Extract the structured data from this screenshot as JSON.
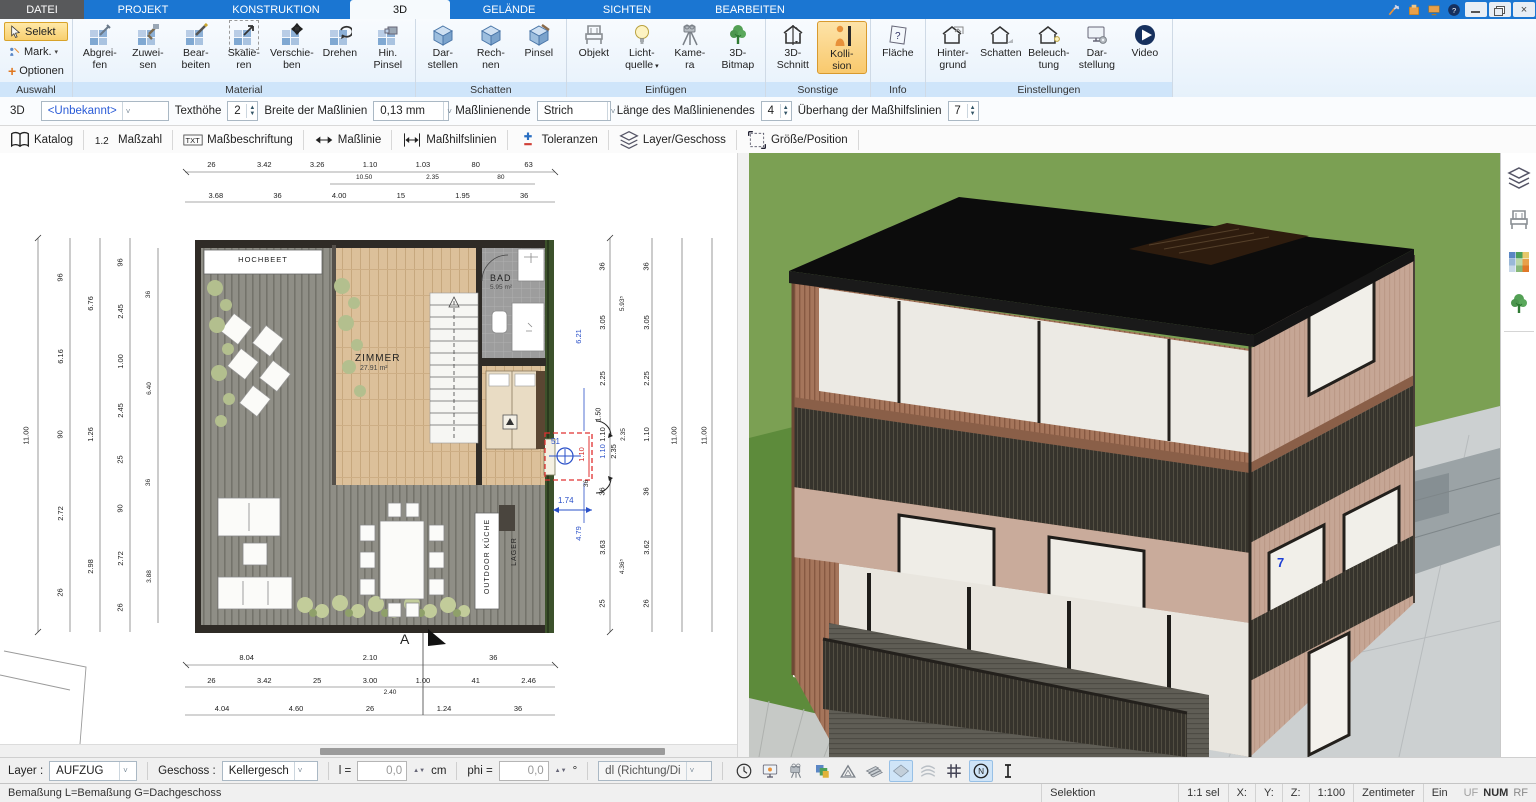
{
  "titlebar": {
    "tabs": [
      "DATEI",
      "PROJEKT",
      "KONSTRUKTION",
      "3D",
      "GELÄNDE",
      "SICHTEN",
      "BEARBEITEN"
    ],
    "active_tab": "3D"
  },
  "ribbon": {
    "selekt": "Selekt",
    "mark": "Mark.",
    "optionen": "Optionen",
    "groups": [
      {
        "label": "Auswahl"
      },
      {
        "label": "Material",
        "buttons": [
          {
            "label": "Abgrei-\nfen",
            "icon": "#i-g-pip"
          },
          {
            "label": "Zuwei-\nsen",
            "icon": "#i-g-brush"
          },
          {
            "label": "Bear-\nbeiten",
            "icon": "#i-g-pen"
          },
          {
            "label": "Skalie-\nren",
            "icon": "#i-g-scale"
          },
          {
            "label": "Verschie-\nben",
            "icon": "#i-g-move"
          },
          {
            "label": "Drehen",
            "icon": "#i-g-rot"
          },
          {
            "label": "Hin.\nPinsel",
            "icon": "#i-g-cam"
          }
        ]
      },
      {
        "label": "Schatten",
        "buttons": [
          {
            "label": "Dar-\nstellen",
            "icon": "#i-cube"
          },
          {
            "label": "Rech-\nnen",
            "icon": "#i-cube"
          },
          {
            "label": "Pinsel",
            "icon": "#i-cube-b"
          }
        ]
      },
      {
        "label": "Einfügen",
        "buttons": [
          {
            "label": "Objekt",
            "icon": "#i-chair"
          },
          {
            "label": "Licht-\nquelle",
            "icon": "#i-bulb"
          },
          {
            "label": "Kame-\nra",
            "icon": "#i-camera"
          },
          {
            "label": "3D-\nBitmap",
            "icon": "#i-tree"
          }
        ]
      },
      {
        "label": "Sonstige",
        "buttons": [
          {
            "label": "3D-\nSchnitt",
            "icon": "#i-house-cut"
          },
          {
            "label": "Kolli-\nsion",
            "icon": "#i-person"
          }
        ]
      },
      {
        "label": "Info",
        "buttons": [
          {
            "label": "Fläche",
            "icon": "#i-flaeche"
          }
        ]
      },
      {
        "label": "Einstellungen",
        "buttons": [
          {
            "label": "Hinter-\ngrund",
            "icon": "#i-house-bg"
          },
          {
            "label": "Schatten",
            "icon": "#i-house-sh"
          },
          {
            "label": "Beleuch-\ntung",
            "icon": "#i-house-li"
          },
          {
            "label": "Dar-\nstellung",
            "icon": "#i-monitor-gear"
          },
          {
            "label": "Video",
            "icon": "#i-video"
          }
        ]
      }
    ]
  },
  "props": {
    "view": "3D",
    "style_value": "<Unbekannt>",
    "texthoehe_label": "Texthöhe",
    "texthoehe_value": "2",
    "breite_label": "Breite der Maßlinien",
    "breite_value": "0,13 mm",
    "ende_label": "Maßlinienende",
    "ende_value": "Strich",
    "laenge_label": "Länge des Maßlinienendes",
    "laenge_value": "4",
    "ueberhang_label": "Überhang der Maßhilfslinien",
    "ueberhang_value": "7"
  },
  "tools": {
    "items": [
      {
        "label": "Katalog",
        "icon": "#i-book"
      },
      {
        "label": "Maßzahl",
        "icon": "#i-12"
      },
      {
        "label": "Maßbeschriftung",
        "icon": "#i-txt"
      },
      {
        "label": "Maßlinie",
        "icon": "#i-arrlr"
      },
      {
        "label": "Maßhilfslinien",
        "icon": "#i-help"
      },
      {
        "label": "Toleranzen",
        "icon": "#i-tol"
      },
      {
        "label": "Layer/Geschoss",
        "icon": "#i-layers"
      },
      {
        "label": "Größe/Position",
        "icon": "#i-sizepos"
      }
    ]
  },
  "plan": {
    "labels": {
      "hochbeet": "HOCHBEET",
      "zimmer": "ZIMMER",
      "zimmer_area": "27.91 m²",
      "bad": "BAD",
      "bad_area": "5.95 m²",
      "outdoor": "OUTDOOR KÜCHE",
      "lager": "LAGER",
      "section": "A"
    },
    "dims": {
      "top1": [
        "26",
        "3.42",
        "3.26",
        "1.10",
        "1.03",
        "80",
        "63"
      ],
      "top1b": [
        "10.50",
        "2.35",
        "80"
      ],
      "top2": [
        "3.68",
        "36",
        "4.00",
        "15",
        "1.95",
        "36"
      ],
      "bottomA": [
        "8.04",
        "2.10",
        "36"
      ],
      "bottomB": [
        "26",
        "3.42",
        "25",
        "3.00",
        "1.00",
        "41",
        "2.46"
      ],
      "bottomB2": [
        "2.40"
      ],
      "bottomC": [
        "4.04",
        "4.60",
        "26",
        "1.24",
        "36"
      ],
      "left1": [
        "11.00"
      ],
      "left2": [
        "96",
        "6.16",
        "90",
        "2.72",
        "26"
      ],
      "left3": [
        "6.76",
        "1.26",
        "2.98"
      ],
      "left4": [
        "96",
        "2.45",
        "1.00",
        "2.45",
        "25",
        "90",
        "2.72",
        "26"
      ],
      "left5": [
        "36",
        "6.40",
        "36",
        "3.88"
      ],
      "rightBlue": [
        "6.21",
        "4.79"
      ],
      "right1": [
        "36",
        "3.05",
        "2.25",
        "1.10",
        "36",
        "3.63",
        "25"
      ],
      "right1b": [
        "5.93⁵",
        "2.35",
        "4.36⁵"
      ],
      "right2": [
        "36",
        "3.05",
        "2.25",
        "1.10",
        "36",
        "3.62",
        "26"
      ],
      "right3": [
        "11.00"
      ],
      "right4": [
        "11.00"
      ],
      "selection": {
        "dia": "51",
        "h": "1.10",
        "arc": "1.50",
        "off": "1.74",
        "w": "1.10",
        "d": "2.35",
        "s": "36"
      }
    }
  },
  "view3d": {
    "annotation": "7"
  },
  "bottombar": {
    "layer_label": "Layer :",
    "layer_value": "AUFZUG",
    "geschoss_label": "Geschoss :",
    "geschoss_value": "Kellergesch",
    "l_label": "l =",
    "l_value": "0,0",
    "l_unit": "cm",
    "phi_label": "phi =",
    "phi_value": "0,0",
    "phi_unit": "°",
    "dl_value": "dl (Richtung/Di",
    "icons": [
      {
        "icon": "#i-clock",
        "name": "clock-icon"
      },
      {
        "icon": "#i-monitor-dot",
        "name": "render-monitor-icon"
      },
      {
        "icon": "#i-cam3d",
        "name": "camera-path-icon"
      },
      {
        "icon": "#i-cubestack",
        "name": "texture-cubes-icon"
      },
      {
        "icon": "#i-setsquare",
        "name": "set-square-icon"
      },
      {
        "icon": "#i-planks",
        "name": "planks-icon"
      },
      {
        "icon": "#i-tile",
        "name": "tile-icon"
      },
      {
        "icon": "#i-sheets",
        "name": "foil-layers-icon"
      },
      {
        "icon": "#i-gridhash",
        "name": "grid-icon"
      },
      {
        "icon": "#i-ncircle",
        "name": "north-icon"
      },
      {
        "icon": "#i-ibeam",
        "name": "column-icon"
      }
    ]
  },
  "sidebar": {
    "icons": [
      {
        "icon": "#i-layers",
        "name": "layers-panel-icon"
      },
      {
        "icon": "#i-chair",
        "name": "objects-panel-icon"
      },
      {
        "icon": "#i-palette",
        "name": "materials-panel-icon"
      },
      {
        "icon": "#i-tree",
        "name": "plants-panel-icon"
      }
    ]
  },
  "statusbar": {
    "left": "Bemaßung L=Bemaßung G=Dachgeschoss",
    "cells": [
      "Selektion",
      "1:1 sel",
      "X:",
      "Y:",
      "Z:",
      "1:100",
      "Zentimeter",
      "Ein",
      "UF",
      "NUM",
      "RF"
    ]
  }
}
